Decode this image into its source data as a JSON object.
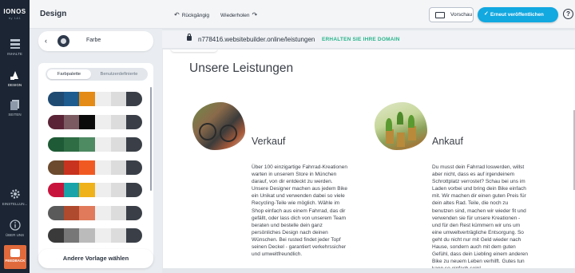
{
  "brand": {
    "logo": "IONOS",
    "sub": "by 1&1"
  },
  "rail": {
    "items": [
      {
        "label": "INHALTE",
        "icon": "layout-icon"
      },
      {
        "label": "DESIGN",
        "icon": "palette-icon"
      },
      {
        "label": "SEITEN",
        "icon": "pages-icon"
      },
      {
        "label": "EINSTELLUN...",
        "icon": "gear-icon"
      },
      {
        "label": "ÜBER UNS",
        "icon": "info-icon"
      }
    ],
    "feedback": "FEEDBACK"
  },
  "header": {
    "title": "Design",
    "undo": "Rückgängig",
    "redo": "Wiederholen",
    "preview": "Vorschau",
    "publish": "Erneut veröffentlichen",
    "help": "?"
  },
  "panel": {
    "section": "Farbe",
    "tabs": [
      "Farbpalette",
      "Benutzerdefinierte"
    ],
    "palettes": [
      [
        "#1f4a72",
        "#1e5b8e",
        "#e38b16",
        "#eeeeee",
        "#dcdcdc",
        "#3a3f47"
      ],
      [
        "#5a2436",
        "#7b5a62",
        "#0b0b0b",
        "#eeeeee",
        "#dcdcdc",
        "#3a3f47"
      ],
      [
        "#1e5a35",
        "#2f6d45",
        "#4e8a62",
        "#eeeeee",
        "#dcdcdc",
        "#3a3f47"
      ],
      [
        "#6b4a2e",
        "#c8331f",
        "#f05a22",
        "#eeeeee",
        "#dcdcdc",
        "#3a3f47"
      ],
      [
        "#c8143c",
        "#1aa3a8",
        "#f0b21a",
        "#eeeeee",
        "#dcdcdc",
        "#3a3f47"
      ],
      [
        "#5a5a5a",
        "#b04a2e",
        "#e07a5a",
        "#eeeeee",
        "#dcdcdc",
        "#3a3f47"
      ],
      [
        "#3a3a3a",
        "#777777",
        "#bbbbbb",
        "#eeeeee",
        "#dcdcdc",
        "#3a3f47"
      ]
    ],
    "template_button": "Andere Vorlage wählen"
  },
  "browser": {
    "url": "n778416.websitebuilder.online/leistungen",
    "domain_cta": "ERHALTEN SIE IHRE DOMAIN"
  },
  "site": {
    "heading": "Unsere Leistungen",
    "services": [
      {
        "title": "Verkauf",
        "text": "Über 100 einzigartige Fahrrad-Kreationen\nwarten in unserem Store in München\ndarauf, von dir entdeckt zu werden.\nUnsere Designer machen aus jedem Bike\nein Unikat und verwenden dabei so viele\nRecycling-Teile wie möglich. Wähle im\nShop einfach aus einem Fahrrad, das dir\ngefällt, oder lass dich von unserem Team\nberaten und bestelle dein ganz\npersönliches Design nach deinen\nWünschen. Bei rusted findet jeder Topf\nseinen Deckel - garantiert verkehrssicher\nund umweltfreundlich."
      },
      {
        "title": "Ankauf",
        "text": "Du musst dein Fahrrad loswerden, willst\naber nicht, dass es auf irgendeinem\nSchrottplatz verrostet? Schau bei uns im\nLaden vorbei und bring dein Bike einfach\nmit. Wir machen dir einen guten Preis für\ndein altes Rad. Teile, die noch zu\nbenutzen sind, machen wir wieder fit und\nverwenden sie für unsere Kreationen -\nund für den Rest kümmern wir uns um\neine umweltverträgliche Entsorgung. So\ngeht du nicht nur mit Geld wieder nach\nHause, sondern auch mit dem guten\nGefühl, dass dein Liebling einem anderen\nBike zu neuem Leben verhilft. Gutes tun\nkann so einfach sein!"
      }
    ]
  },
  "colors": {
    "accent": "#12a8e0",
    "rail": "#1b2533",
    "domain": "#28b48c",
    "feedback": "#e06a3c"
  }
}
